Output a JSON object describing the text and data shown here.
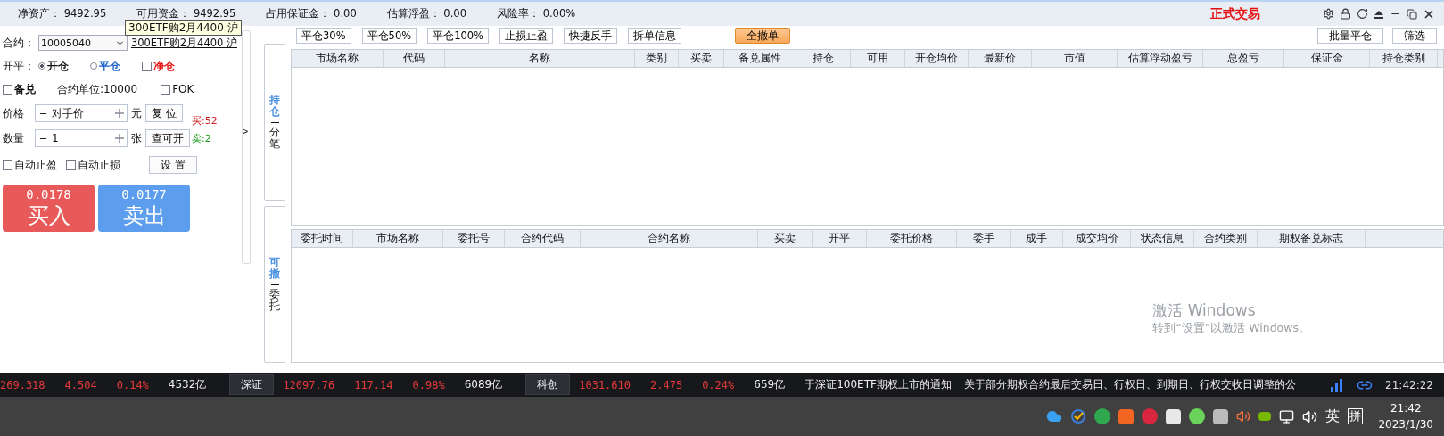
{
  "account_bar": {
    "items": [
      {
        "label": "净资产：",
        "value": "9492.95"
      },
      {
        "label": "可用资金：",
        "value": "9492.95"
      },
      {
        "label": "占用保证金：",
        "value": "0.00"
      },
      {
        "label": "估算浮盈：",
        "value": "0.00"
      },
      {
        "label": "风险率：",
        "value": "0.00%"
      }
    ],
    "tooltip": "300ETF购2月4400 沪",
    "mode": "正式交易"
  },
  "order_panel": {
    "contract_label": "合约：",
    "contract_code": "10005040",
    "contract_name": "300ETF购2月4400 沪",
    "open_close_label": "开平：",
    "open_close": [
      {
        "label": "开仓",
        "selected": true
      },
      {
        "label": "平仓",
        "selected": false
      }
    ],
    "net_position": {
      "label": "净仓",
      "checked": false
    },
    "covered": {
      "label": "备兑",
      "checked": false
    },
    "unit": "合约单位:10000",
    "fok": {
      "label": "FOK",
      "checked": false
    },
    "price": {
      "label": "价格",
      "value": "对手价",
      "unit": "元",
      "button": "复 位"
    },
    "quantity": {
      "label": "数量",
      "value": "1",
      "unit": "张",
      "button": "查可开"
    },
    "buy_max": "买:52",
    "sell_max": "卖:2",
    "auto": [
      {
        "label": "自动止盈",
        "checked": false
      },
      {
        "label": "自动止损",
        "checked": false
      }
    ],
    "settings_button": "设 置",
    "buy": {
      "price": "0.0178",
      "label": "买入"
    },
    "sell": {
      "price": "0.0177",
      "label": "卖出"
    }
  },
  "collapse_toggle": ">",
  "side_tabs": [
    {
      "title": "持仓",
      "subtitle": "分笔"
    },
    {
      "title": "可撤",
      "subtitle": "委托"
    }
  ],
  "actions": [
    {
      "label": "平仓30%",
      "kind": "normal"
    },
    {
      "label": "平仓50%",
      "kind": "normal"
    },
    {
      "label": "平仓100%",
      "kind": "normal"
    },
    {
      "label": "止损止盈",
      "kind": "normal"
    },
    {
      "label": "快捷反手",
      "kind": "normal"
    },
    {
      "label": "拆单信息",
      "kind": "normal"
    },
    {
      "label": "全撤单",
      "kind": "primary"
    }
  ],
  "right_actions": [
    "批量平仓",
    "筛选"
  ],
  "positions_table": {
    "columns": [
      "市场名称",
      "代码",
      "名称",
      "类别",
      "买卖",
      "备兑属性",
      "持仓",
      "可用",
      "开仓均价",
      "最新价",
      "市值",
      "估算浮动盈亏",
      "总盈亏",
      "保证金",
      "持仓类别"
    ]
  },
  "orders_table": {
    "columns": [
      "委托时间",
      "市场名称",
      "委托号",
      "合约代码",
      "合约名称",
      "买卖",
      "开平",
      "委托价格",
      "委手",
      "成手",
      "成交均价",
      "状态信息",
      "合约类别",
      "期权备兑标志"
    ]
  },
  "watermark": {
    "title": "激活 Windows",
    "hint": "转到“设置”以激活 Windows。"
  },
  "ticker": {
    "items": [
      {
        "kind": "change",
        "text": "269.318"
      },
      {
        "kind": "change",
        "text": "4.504"
      },
      {
        "kind": "change",
        "text": "0.14%"
      },
      {
        "kind": "volume",
        "text": "4532亿"
      },
      {
        "kind": "market",
        "text": "深证"
      },
      {
        "kind": "change",
        "text": "12097.76"
      },
      {
        "kind": "change",
        "text": "117.14"
      },
      {
        "kind": "change",
        "text": "0.98%"
      },
      {
        "kind": "volume",
        "text": "6089亿"
      },
      {
        "kind": "market",
        "text": "科创"
      },
      {
        "kind": "change",
        "text": "1031.610"
      },
      {
        "kind": "change",
        "text": "2.475"
      },
      {
        "kind": "change",
        "text": "0.24%"
      },
      {
        "kind": "volume",
        "text": "659亿"
      },
      {
        "kind": "news",
        "text": "于深证100ETF期权上市的通知"
      },
      {
        "kind": "news",
        "text": "关于部分期权合约最后交易日、行权日、到期日、行权交收日调整的公"
      }
    ],
    "time": "21:42:22"
  },
  "taskbar": {
    "language": "英",
    "ime": "拼",
    "time": "21:42",
    "date": "2023/1/30"
  }
}
